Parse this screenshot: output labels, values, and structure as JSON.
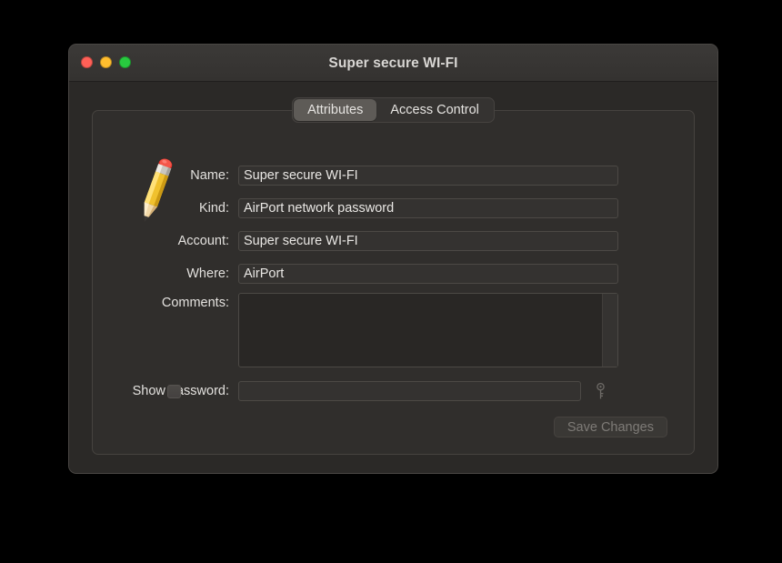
{
  "window": {
    "title": "Super secure WI-FI",
    "traffic_lights": [
      {
        "name": "close",
        "color": "#ff6057"
      },
      {
        "name": "minimize",
        "color": "#ffbd2e"
      },
      {
        "name": "maximize",
        "color": "#28c93f"
      }
    ]
  },
  "tabs": [
    {
      "label": "Attributes",
      "selected": true
    },
    {
      "label": "Access Control",
      "selected": false
    }
  ],
  "item_icon": "pencil-with-dots-icon",
  "form": {
    "name": {
      "label": "Name:",
      "value": "Super secure WI-FI"
    },
    "kind": {
      "label": "Kind:",
      "value": "AirPort network password"
    },
    "account": {
      "label": "Account:",
      "value": "Super secure WI-FI"
    },
    "where": {
      "label": "Where:",
      "value": "AirPort"
    },
    "comments": {
      "label": "Comments:",
      "value": ""
    },
    "show_password": {
      "label": "Show password:",
      "value": "",
      "checked": false
    }
  },
  "buttons": {
    "save_changes": {
      "label": "Save Changes",
      "enabled": false
    }
  },
  "icons": {
    "key": "key-icon"
  },
  "colors": {
    "desktop_background": "#000000",
    "window_background": "#2b2927",
    "panel_background": "#302e2c",
    "field_background": "#343230",
    "text_primary": "#e9e7e4",
    "text_disabled": "#7e7b77",
    "tab_selected": "#5e5b57"
  }
}
